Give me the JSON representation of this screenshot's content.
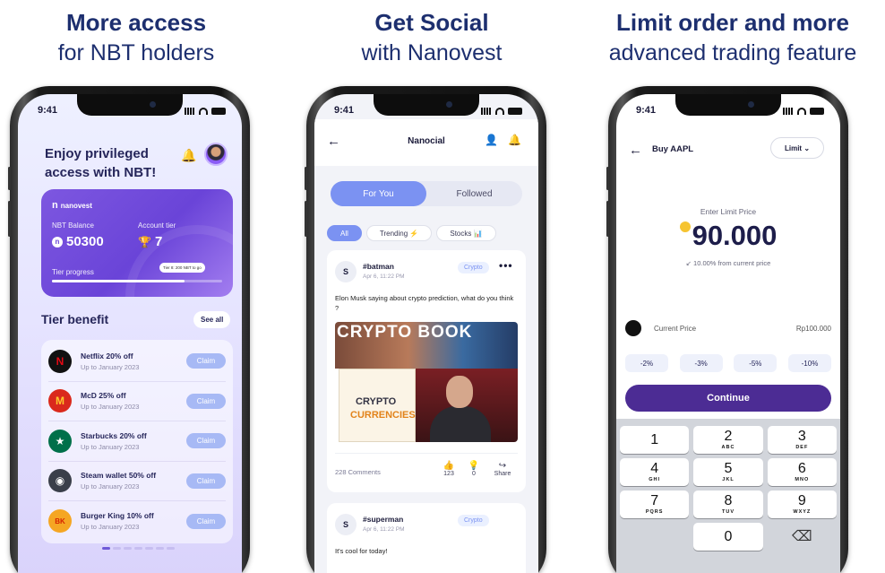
{
  "headlines": [
    {
      "line1": "More access",
      "line2": "for NBT holders"
    },
    {
      "line1": "Get Social",
      "line2": "with Nanovest"
    },
    {
      "line1": "Limit order and more",
      "line2": "advanced trading feature"
    }
  ],
  "status_time": "9:41",
  "phone1": {
    "title": "Enjoy privileged access with NBT!",
    "icons": {
      "bell": "bell-icon",
      "avatar": "avatar"
    },
    "card": {
      "brand": "nanovest",
      "balance_label": "NBT Balance",
      "balance_value": "50300",
      "tier_label": "Account tier",
      "tier_value": "7",
      "progress_label": "Tier progress",
      "progress_fraction": 0.78,
      "tooltip": "Tier 8: 200 NBT to go"
    },
    "section_title": "Tier benefit",
    "see_all": "See all",
    "benefits": [
      {
        "name": "Netflix 20% off",
        "date": "Up to January 2023",
        "claim": "Claim",
        "logo": "N",
        "color": "#111111",
        "fg": "#e50914"
      },
      {
        "name": "McD 25% off",
        "date": "Up to January 2023",
        "claim": "Claim",
        "logo": "M",
        "color": "#da291c",
        "fg": "#ffc72c"
      },
      {
        "name": "Starbucks 20% off",
        "date": "Up to January 2023",
        "claim": "Claim",
        "logo": "★",
        "color": "#00704a",
        "fg": "#ffffff"
      },
      {
        "name": "Steam wallet 50% off",
        "date": "Up to January 2023",
        "claim": "Claim",
        "logo": "◉",
        "color": "#3a3f4a",
        "fg": "#ffffff"
      },
      {
        "name": "Burger King 10% off",
        "date": "Up to January 2023",
        "claim": "Claim",
        "logo": "BK",
        "color": "#f5a623",
        "fg": "#d62300"
      }
    ]
  },
  "phone2": {
    "title": "Nanocial",
    "tabs": [
      "For You",
      "Followed"
    ],
    "chips": [
      "All",
      "Trending ⚡",
      "Stocks 📊"
    ],
    "posts": [
      {
        "avatar": "S",
        "user": "#batman",
        "date": "Apr 6, 11:22 PM",
        "tag": "Crypto",
        "body": "Elon Musk saying about crypto prediction, what do you think ?",
        "image_text": "CRYPTO BOOK",
        "book_line1": "CRYPTO",
        "book_line2": "CURRENCIES",
        "comments": "228 Comments",
        "likes": "123",
        "reactions": "0",
        "share": "Share"
      },
      {
        "avatar": "S",
        "user": "#superman",
        "date": "Apr 6, 11:22 PM",
        "tag": "Crypto",
        "body": "It's cool for today!"
      }
    ]
  },
  "phone3": {
    "title": "Buy AAPL",
    "order_type": "Limit",
    "limit_label": "Enter Limit Price",
    "limit_value": "90.000",
    "limit_pct": "↙ 10.00% from current price",
    "current_label": "Current Price",
    "current_value": "Rp100.000",
    "percent_buttons": [
      "-2%",
      "-3%",
      "-5%",
      "-10%"
    ],
    "continue": "Continue",
    "keys": [
      {
        "d": "1",
        "l": ""
      },
      {
        "d": "2",
        "l": "ABC"
      },
      {
        "d": "3",
        "l": "DEF"
      },
      {
        "d": "4",
        "l": "GHI"
      },
      {
        "d": "5",
        "l": "JKL"
      },
      {
        "d": "6",
        "l": "MNO"
      },
      {
        "d": "7",
        "l": "PQRS"
      },
      {
        "d": "8",
        "l": "TUV"
      },
      {
        "d": "9",
        "l": "WXYZ"
      },
      {
        "d": "",
        "l": ""
      },
      {
        "d": "0",
        "l": ""
      },
      {
        "d": "⌫",
        "l": ""
      }
    ]
  },
  "colors": {
    "headline": "#1d2f6f",
    "accent": "#7b92f2",
    "primary": "#4c2c94",
    "card": "#6a44d8"
  }
}
